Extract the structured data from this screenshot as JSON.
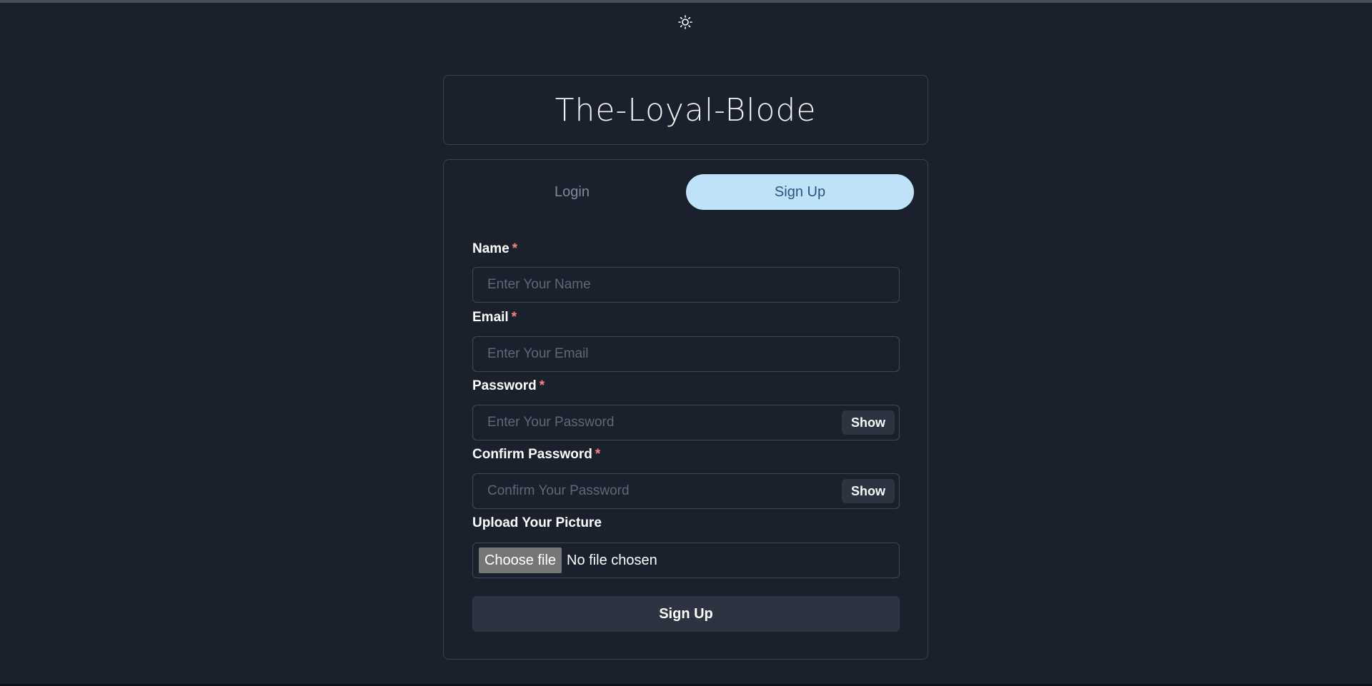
{
  "theme_toggle": {
    "icon": "sun-icon"
  },
  "app": {
    "title": "The-Loyal-Blode"
  },
  "tabs": [
    {
      "label": "Login",
      "active": false
    },
    {
      "label": "Sign Up",
      "active": true
    }
  ],
  "form": {
    "name": {
      "label": "Name",
      "required_mark": "*",
      "placeholder": "Enter Your Name",
      "value": ""
    },
    "email": {
      "label": "Email",
      "required_mark": "*",
      "placeholder": "Enter Your Email",
      "value": ""
    },
    "password": {
      "label": "Password",
      "required_mark": "*",
      "placeholder": "Enter Your Password",
      "value": "",
      "toggle_label": "Show"
    },
    "confirm_password": {
      "label": "Confirm Password",
      "required_mark": "*",
      "placeholder": "Confirm Your Password",
      "value": "",
      "toggle_label": "Show"
    },
    "picture": {
      "label": "Upload Your Picture",
      "button_label": "Choose file",
      "status": "No file chosen"
    },
    "submit_label": "Sign Up"
  },
  "colors": {
    "background": "#1a202c",
    "active_tab_bg": "#bee3f8",
    "active_tab_text": "#2c5282",
    "required": "#fc8181",
    "button_bg": "#2d3340"
  }
}
